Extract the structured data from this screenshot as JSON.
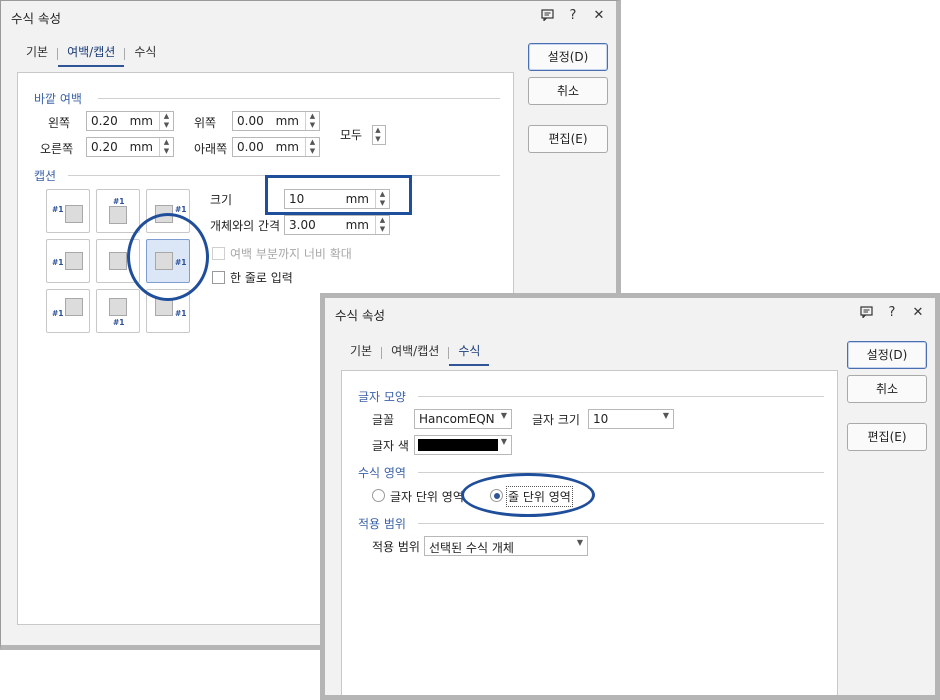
{
  "dialog1": {
    "title": "수식 속성",
    "icons": [
      "speech-bubble-icon",
      "help-icon",
      "close-icon"
    ],
    "help_glyph": "?",
    "close_glyph": "✕",
    "tabs": [
      {
        "label": "기본"
      },
      {
        "label": "여백/캡션",
        "active": true
      },
      {
        "label": "수식"
      }
    ],
    "buttons": {
      "ok": "설정(D)",
      "cancel": "취소",
      "edit": "편집(E)"
    },
    "outer_margin": {
      "label": "바깥 여백",
      "left": {
        "label": "왼쪽",
        "value": "0.20",
        "unit": "mm"
      },
      "top": {
        "label": "위쪽",
        "value": "0.00",
        "unit": "mm"
      },
      "right": {
        "label": "오른쪽",
        "value": "0.20",
        "unit": "mm"
      },
      "bottom": {
        "label": "아래쪽",
        "value": "0.00",
        "unit": "mm"
      },
      "all": {
        "label": "모두"
      }
    },
    "caption": {
      "label": "캡션",
      "tag": "#1",
      "size": {
        "label": "크기",
        "value": "10",
        "unit": "mm"
      },
      "spacing": {
        "label": "개체와의 간격",
        "value": "3.00",
        "unit": "mm"
      },
      "expand_width": {
        "label": "여백 부분까지 너비 확대",
        "checked": false,
        "enabled": false
      },
      "single_line": {
        "label": "한 줄로 입력",
        "checked": false
      },
      "selected_position": "right-center"
    }
  },
  "dialog2": {
    "title": "수식 속성",
    "icons": [
      "speech-bubble-icon",
      "help-icon",
      "close-icon"
    ],
    "help_glyph": "?",
    "close_glyph": "✕",
    "tabs": [
      {
        "label": "기본"
      },
      {
        "label": "여백/캡션"
      },
      {
        "label": "수식",
        "active": true
      }
    ],
    "buttons": {
      "ok": "설정(D)",
      "cancel": "취소",
      "edit": "편집(E)"
    },
    "char_shape": {
      "label": "글자 모양",
      "font": {
        "label": "글꼴",
        "value": "HancomEQN"
      },
      "size": {
        "label": "글자 크기",
        "value": "10"
      },
      "color": {
        "label": "글자 색",
        "value": "#000000"
      }
    },
    "formula_area": {
      "label": "수식 영역",
      "options": [
        {
          "label": "글자 단위 영역",
          "checked": false
        },
        {
          "label": "줄 단위 영역",
          "checked": true
        }
      ]
    },
    "apply_scope": {
      "label": "적용 범위",
      "field_label": "적용 범위",
      "value": "선택된 수식 개체"
    }
  },
  "highlight_color": "#1f4e9a",
  "accent": "#3b63a8"
}
